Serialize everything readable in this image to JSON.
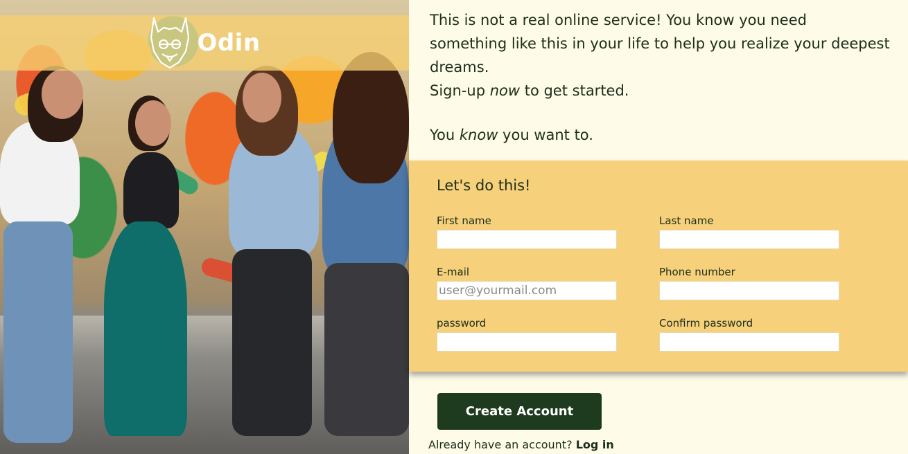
{
  "brand": {
    "name": "Odin",
    "logo_icon": "odin-dog-logo"
  },
  "intro": {
    "line1": "This is not a real online service! You know you need",
    "line2": "something like this in your life to help you realize your deepest",
    "line3": "dreams.",
    "line4_pre": "Sign-up ",
    "line4_em": "now",
    "line4_post": " to get started.",
    "line5_pre": "You ",
    "line5_em": "know",
    "line5_post": " you want to."
  },
  "form": {
    "title": "Let's do this!",
    "fields": {
      "first_name": {
        "label": "First name",
        "value": "",
        "placeholder": ""
      },
      "last_name": {
        "label": "Last name",
        "value": "",
        "placeholder": ""
      },
      "email": {
        "label": "E-mail",
        "value": "",
        "placeholder": "user@yourmail.com"
      },
      "phone": {
        "label": "Phone number",
        "value": "",
        "placeholder": ""
      },
      "password": {
        "label": "password",
        "value": "",
        "placeholder": ""
      },
      "confirm_password": {
        "label": "Confirm password",
        "value": "",
        "placeholder": ""
      }
    }
  },
  "actions": {
    "create_label": "Create Account",
    "login_prompt": "Already have an account?",
    "login_link": "Log in"
  },
  "colors": {
    "accent_yellow": "#f6d07a",
    "dark_green": "#1e3b1f",
    "background": "#fefbe8"
  }
}
